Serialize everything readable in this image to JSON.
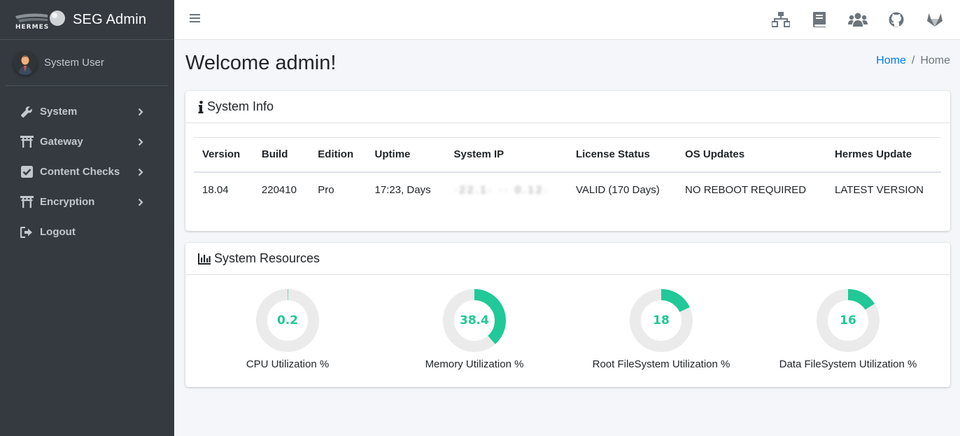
{
  "brand": {
    "logo_text": "HERMES",
    "title": "SEG Admin"
  },
  "user": {
    "name": "System User"
  },
  "sidebar": {
    "items": [
      {
        "label": "System",
        "icon": "wrench-icon",
        "has_children": true
      },
      {
        "label": "Gateway",
        "icon": "torii-gate-icon",
        "has_children": true
      },
      {
        "label": "Content Checks",
        "icon": "check-square-icon",
        "has_children": true
      },
      {
        "label": "Encryption",
        "icon": "torii-gate-icon",
        "has_children": true
      },
      {
        "label": "Logout",
        "icon": "sign-out-icon",
        "has_children": false
      }
    ]
  },
  "topbar": {
    "icons": [
      "network-icon",
      "book-icon",
      "users-icon",
      "github-icon",
      "gitlab-icon"
    ]
  },
  "page": {
    "title": "Welcome admin!"
  },
  "breadcrumb": {
    "home": "Home",
    "separator": "/",
    "active": "Home"
  },
  "system_info": {
    "title": "System Info",
    "columns": [
      "Version",
      "Build",
      "Edition",
      "Uptime",
      "System IP",
      "License Status",
      "OS Updates",
      "Hermes Update"
    ],
    "row": [
      "18.04",
      "220410",
      "Pro",
      "17:23, Days",
      "·22.1· ·· 0.12·",
      "VALID (170 Days)",
      "NO REBOOT REQUIRED",
      "LATEST VERSION"
    ]
  },
  "system_resources": {
    "title": "System Resources",
    "gauges": [
      {
        "value": "0.2",
        "percent": 0.2,
        "label": "CPU Utilization %"
      },
      {
        "value": "38.4",
        "percent": 38.4,
        "label": "Memory Utilization %"
      },
      {
        "value": "18",
        "percent": 18,
        "label": "Root FileSystem Utilization %"
      },
      {
        "value": "16",
        "percent": 16,
        "label": "Data FileSystem Utilization %"
      }
    ]
  },
  "colors": {
    "sidebar_bg": "#343a40",
    "accent": "#20c997",
    "track": "#ebebeb",
    "link": "#007bff"
  }
}
